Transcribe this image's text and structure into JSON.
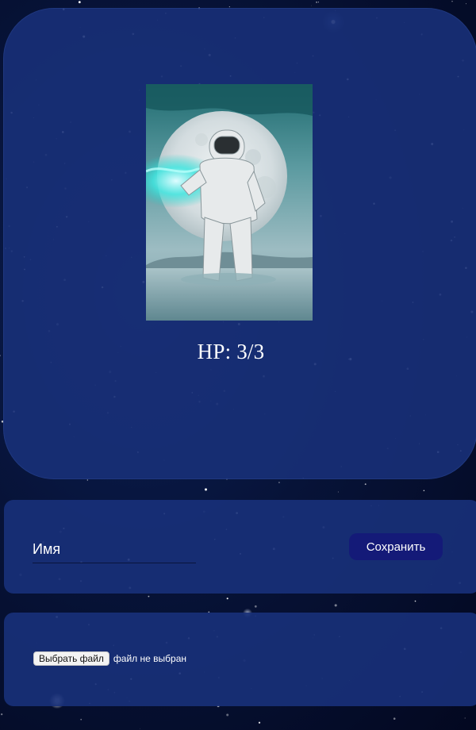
{
  "profile": {
    "avatar_image": "astronaut-in-front-of-moon-image",
    "hp_text": "HP: 3/3"
  },
  "name_form": {
    "placeholder": "Имя",
    "save_label": "Сохранить"
  },
  "file_form": {
    "choose_label": "Выбрать файл",
    "status_text": "файл не выбран"
  },
  "colors": {
    "card_bg": "#18307a",
    "save_button": "#141a78",
    "text": "#ffffff"
  }
}
